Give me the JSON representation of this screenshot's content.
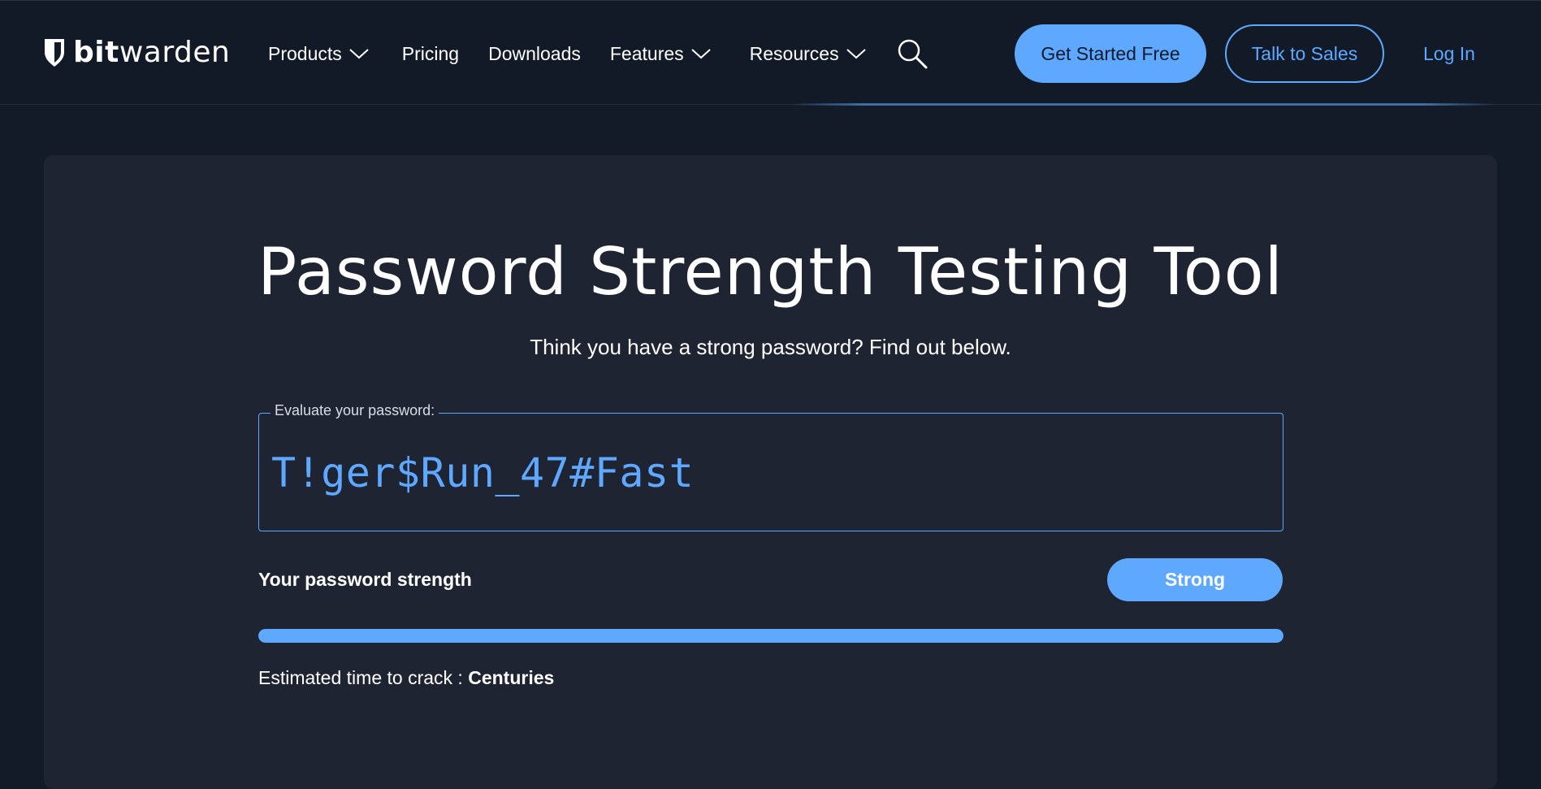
{
  "header": {
    "logo": {
      "bold": "bit",
      "light": "warden"
    },
    "nav": [
      {
        "label": "Products",
        "has_dropdown": true
      },
      {
        "label": "Pricing",
        "has_dropdown": false
      },
      {
        "label": "Downloads",
        "has_dropdown": false
      },
      {
        "label": "Features",
        "has_dropdown": true
      },
      {
        "label": "Resources",
        "has_dropdown": true
      }
    ],
    "search_icon": "search-icon",
    "cta_primary": "Get Started Free",
    "cta_secondary": "Talk to Sales",
    "login": "Log In"
  },
  "main": {
    "title": "Password Strength Testing Tool",
    "subtitle": "Think you have a strong password? Find out below.",
    "password_field": {
      "legend": "Evaluate your password:",
      "value": "T!ger$Run_47#Fast"
    },
    "strength": {
      "label": "Your password strength",
      "rating": "Strong",
      "fill_percent": 100
    },
    "crack_time": {
      "label": "Estimated time to crack : ",
      "value": "Centuries"
    }
  },
  "colors": {
    "page_bg": "#131a28",
    "header_bg": "#121927",
    "card_bg": "#1f2433",
    "accent": "#5ea9ff",
    "text": "#ffffff"
  }
}
